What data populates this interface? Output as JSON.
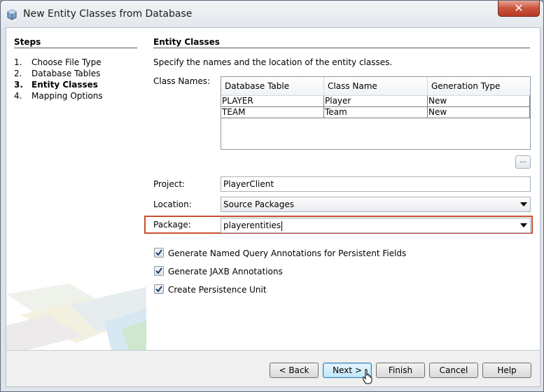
{
  "window": {
    "title": "New Entity Classes from Database"
  },
  "steps": {
    "title": "Steps",
    "items": [
      {
        "num": "1.",
        "label": "Choose File Type"
      },
      {
        "num": "2.",
        "label": "Database Tables"
      },
      {
        "num": "3.",
        "label": "Entity Classes"
      },
      {
        "num": "4.",
        "label": "Mapping Options"
      }
    ],
    "current": 2
  },
  "main": {
    "title": "Entity Classes",
    "description": "Specify the names and the location of the entity classes.",
    "class_names_label": "Class Names:",
    "table": {
      "headers": [
        "Database Table",
        "Class Name",
        "Generation Type"
      ],
      "rows": [
        [
          "PLAYER",
          "Player",
          "New"
        ],
        [
          "TEAM",
          "Team",
          "New"
        ]
      ]
    },
    "ellipsis_label": "...",
    "project_label": "Project:",
    "project_value": "PlayerClient",
    "location_label": "Location:",
    "location_value": "Source Packages",
    "package_label": "Package:",
    "package_value": "playerentities",
    "checkboxes": [
      {
        "label": "Generate Named Query Annotations for Persistent Fields",
        "checked": true
      },
      {
        "label": "Generate JAXB Annotations",
        "checked": true
      },
      {
        "label": "Create Persistence Unit",
        "checked": true
      }
    ],
    "highlight_color": "#c8502e"
  },
  "buttons": {
    "back": "< Back",
    "next": "Next >",
    "finish": "Finish",
    "cancel": "Cancel",
    "help": "Help"
  },
  "title_bar": {
    "close_icon": "close-icon"
  }
}
